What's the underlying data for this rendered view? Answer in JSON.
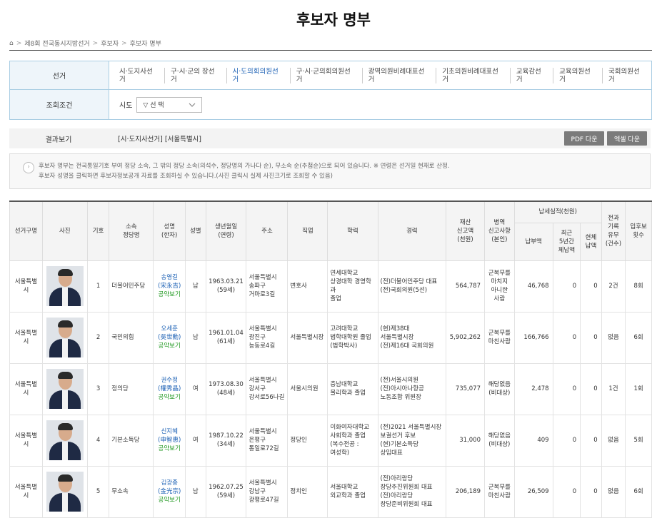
{
  "page_title": "후보자 명부",
  "breadcrumb": [
    "제8회 전국동시지방선거",
    "후보자",
    "후보자 명부"
  ],
  "filter": {
    "election_label": "선거",
    "election_tabs": [
      "시·도지사선거",
      "구·시·군의 장선거",
      "시·도의회의원선거",
      "구·시·군의회의원선거",
      "광역의원비례대표선거",
      "기초의원비례대표선거",
      "교육감선거",
      "교육의원선거",
      "국회의원선거"
    ],
    "active_tab": 2,
    "condition_label": "조회조건",
    "sido_label": "시도",
    "sido_value": "▽ 선 택"
  },
  "result": {
    "label": "결과보기",
    "text": "[시·도지사선거] [서울특별시]",
    "pdf_label": "PDF 다운",
    "excel_label": "엑셀 다운"
  },
  "notice": {
    "line1": "후보자 명부는 전국통일기호 부여 정당 소속, 그 밖의 정당 소속(의석수, 정당명의 가나다 순), 무소속 순(추첨순)으로 되어 있습니다. ※ 연령은 선거일 현재로 산정.",
    "line2": "후보자 성명을 클릭하면 후보자정보공개 자료를 조회하실 수 있습니다.(사진 클릭시 실제 사진크기로 조회할 수 있음)"
  },
  "table": {
    "headers": {
      "district": "선거구명",
      "photo": "사진",
      "number": "기호",
      "party": "소속\n정당명",
      "name": "성명\n(한자)",
      "gender": "성별",
      "birth": "생년월일\n(연령)",
      "address": "주소",
      "job": "직업",
      "education": "학력",
      "career": "경력",
      "property": "재산\n신고액\n(천원)",
      "military": "병역\n신고사항\n(본인)",
      "tax_group": "납세실적(천원)",
      "tax_paid": "납부액",
      "tax_arrears5": "최근\n5년간\n체납액",
      "tax_current": "현체\n납액",
      "criminal": "전과\n기록\n유무\n(건수)",
      "runs": "입후보\n횟수"
    },
    "rows": [
      {
        "district": "서울특별시",
        "number": "1",
        "party": "더불어민주당",
        "name": "송영길",
        "hanja": "(宋永吉)",
        "pledge": "공약보기",
        "gender": "남",
        "birth": "1963.03.21",
        "age": "(59세)",
        "address": "서울특별시\n송파구\n거마로3길",
        "job": "변호사",
        "education": "연세대학교\n상경대학 경영학과\n졸업",
        "career": "(전)더불어민주당 대표\n(전)국회의원(5선)",
        "property": "564,787",
        "military": "군복무를\n마치지\n아니한\n사람",
        "tax_paid": "46,768",
        "tax_arrears5": "0",
        "tax_current": "0",
        "criminal": "2건",
        "runs": "8회"
      },
      {
        "district": "서울특별시",
        "number": "2",
        "party": "국민의힘",
        "name": "오세훈",
        "hanja": "(吳世勳)",
        "pledge": "공약보기",
        "gender": "남",
        "birth": "1961.01.04",
        "age": "(61세)",
        "address": "서울특별시\n광진구\n능동로4길",
        "job": "서울특별시장",
        "education": "고려대학교\n법학대학원 졸업\n(법학박사)",
        "career": "(현)제38대\n서울특별시장\n(전)제16대 국회의원",
        "property": "5,902,262",
        "military": "군복무를\n마친사람",
        "tax_paid": "166,766",
        "tax_arrears5": "0",
        "tax_current": "0",
        "criminal": "없음",
        "runs": "6회"
      },
      {
        "district": "서울특별시",
        "number": "3",
        "party": "정의당",
        "name": "권수정",
        "hanja": "(權秀晶)",
        "pledge": "공약보기",
        "gender": "여",
        "birth": "1973.08.30",
        "age": "(48세)",
        "address": "서울특별시\n강서구\n강서로56나길",
        "job": "서울시의원",
        "education": "충남대학교\n물리학과 졸업",
        "career": "(전)서울시의원\n(전)아시아나항공\n노동조합 위원장",
        "property": "735,077",
        "military": "해당없음\n(비대상)",
        "tax_paid": "2,478",
        "tax_arrears5": "0",
        "tax_current": "0",
        "criminal": "1건",
        "runs": "1회"
      },
      {
        "district": "서울특별시",
        "number": "4",
        "party": "기본소득당",
        "name": "신지혜",
        "hanja": "(申智惠)",
        "pledge": "공약보기",
        "gender": "여",
        "birth": "1987.10.22",
        "age": "(34세)",
        "address": "서울특별시\n은평구\n통일로72길",
        "job": "정당인",
        "education": "이화여자대학교\n사회학과 졸업\n(복수전공 :\n여성학)",
        "career": "(전)2021 서울특별시장\n보궐선거 후보\n(현)기본소득당\n상임대표",
        "property": "31,000",
        "military": "해당없음\n(비대상)",
        "tax_paid": "409",
        "tax_arrears5": "0",
        "tax_current": "0",
        "criminal": "없음",
        "runs": "5회"
      },
      {
        "district": "서울특별시",
        "number": "5",
        "party": "무소속",
        "name": "김광종",
        "hanja": "(金光宗)",
        "pledge": "공약보기",
        "gender": "남",
        "birth": "1962.07.25",
        "age": "(59세)",
        "address": "서울특별시\n강남구\n광평로47길",
        "job": "정치인",
        "education": "서울대학교\n외교학과 졸업",
        "career": "(전)아리랑당\n창당추진위원회 대표\n(전)아리랑당\n창당준비위원회 대표",
        "property": "206,189",
        "military": "군복무를\n마친사람",
        "tax_paid": "26,509",
        "tax_arrears5": "0",
        "tax_current": "0",
        "criminal": "없음",
        "runs": "6회"
      }
    ]
  },
  "colors": {
    "accent_blue": "#1a5fb4",
    "pledge_green": "#229922",
    "button_gray": "#7b7b7b",
    "filter_border": "#a9cde3"
  }
}
